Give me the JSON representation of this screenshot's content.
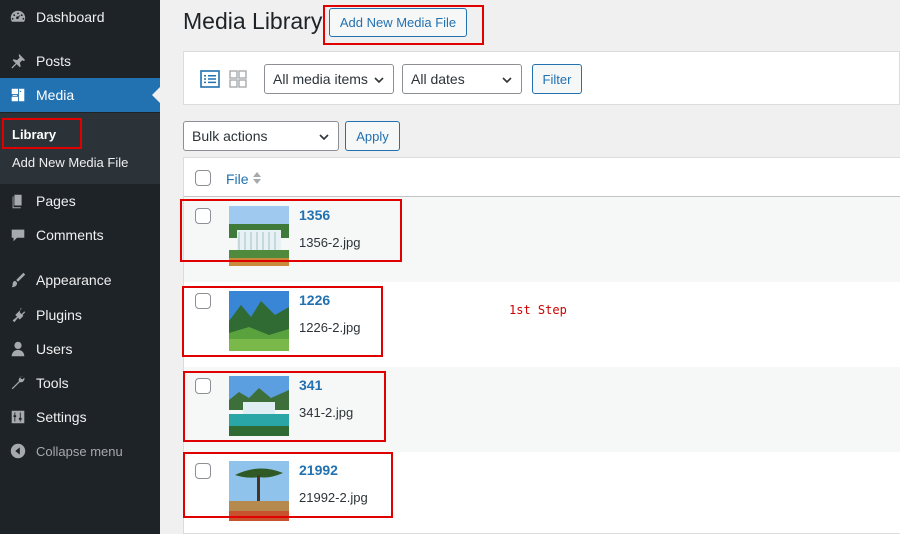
{
  "sidebar": {
    "items": [
      {
        "label": "Dashboard",
        "icon": "dashboard-icon"
      },
      {
        "label": "Posts",
        "icon": "pin-icon"
      },
      {
        "label": "Media",
        "icon": "media-icon"
      },
      {
        "label": "Pages",
        "icon": "pages-icon"
      },
      {
        "label": "Comments",
        "icon": "comment-icon"
      },
      {
        "label": "Appearance",
        "icon": "brush-icon"
      },
      {
        "label": "Plugins",
        "icon": "plugin-icon"
      },
      {
        "label": "Users",
        "icon": "user-icon"
      },
      {
        "label": "Tools",
        "icon": "wrench-icon"
      },
      {
        "label": "Settings",
        "icon": "settings-icon"
      }
    ],
    "submenu": [
      {
        "label": "Library"
      },
      {
        "label": "Add New Media File"
      }
    ],
    "collapse_label": "Collapse menu"
  },
  "page": {
    "title": "Media Library",
    "add_new_label": "Add New Media File"
  },
  "toolbar": {
    "media_filter": "All media items",
    "date_filter": "All dates",
    "filter_label": "Filter"
  },
  "bulk": {
    "selected": "Bulk actions",
    "apply_label": "Apply"
  },
  "table": {
    "column_file": "File",
    "rows": [
      {
        "title": "1356",
        "filename": "1356-2.jpg"
      },
      {
        "title": "1226",
        "filename": "1226-2.jpg"
      },
      {
        "title": "341",
        "filename": "341-2.jpg"
      },
      {
        "title": "21992",
        "filename": "21992-2.jpg"
      }
    ]
  },
  "annotation": {
    "note": "1st Step"
  },
  "colors": {
    "sidebar_bg": "#1d2327",
    "accent": "#2271b1",
    "highlight_red": "#e00000"
  }
}
